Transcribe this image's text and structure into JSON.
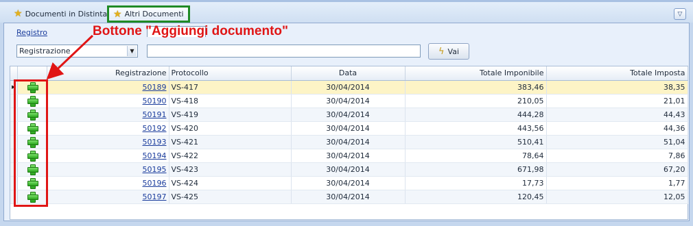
{
  "tabs": [
    {
      "label": "Documenti in Distinta",
      "icon": "star-icon"
    },
    {
      "label": "Altri Documenti",
      "icon": "star-icon"
    }
  ],
  "filter": {
    "registro_label": "Registro",
    "field_select_value": "Registrazione",
    "search_value": "",
    "go_label": "Vai"
  },
  "grid": {
    "columns": [
      "",
      "Registrazione",
      "Protocollo",
      "Data",
      "Totale Imponibile",
      "Totale Imposta"
    ],
    "rows": [
      {
        "registrazione": "50189",
        "protocollo": "VS-417",
        "data": "30/04/2014",
        "imponibile": "383,46",
        "imposta": "38,35"
      },
      {
        "registrazione": "50190",
        "protocollo": "VS-418",
        "data": "30/04/2014",
        "imponibile": "210,05",
        "imposta": "21,01"
      },
      {
        "registrazione": "50191",
        "protocollo": "VS-419",
        "data": "30/04/2014",
        "imponibile": "444,28",
        "imposta": "44,43"
      },
      {
        "registrazione": "50192",
        "protocollo": "VS-420",
        "data": "30/04/2014",
        "imponibile": "443,56",
        "imposta": "44,36"
      },
      {
        "registrazione": "50193",
        "protocollo": "VS-421",
        "data": "30/04/2014",
        "imponibile": "510,41",
        "imposta": "51,04"
      },
      {
        "registrazione": "50194",
        "protocollo": "VS-422",
        "data": "30/04/2014",
        "imponibile": "78,64",
        "imposta": "7,86"
      },
      {
        "registrazione": "50195",
        "protocollo": "VS-423",
        "data": "30/04/2014",
        "imponibile": "671,98",
        "imposta": "67,20"
      },
      {
        "registrazione": "50196",
        "protocollo": "VS-424",
        "data": "30/04/2014",
        "imponibile": "17,73",
        "imposta": "1,77"
      },
      {
        "registrazione": "50197",
        "protocollo": "VS-425",
        "data": "30/04/2014",
        "imponibile": "120,45",
        "imposta": "12,05"
      }
    ]
  },
  "annotation": {
    "text": "Bottone \"Aggiungi documento\"",
    "color": "#e01515"
  },
  "colors": {
    "highlight_tab_border": "#1f8a25",
    "selected_row": "#fdf4c6"
  }
}
